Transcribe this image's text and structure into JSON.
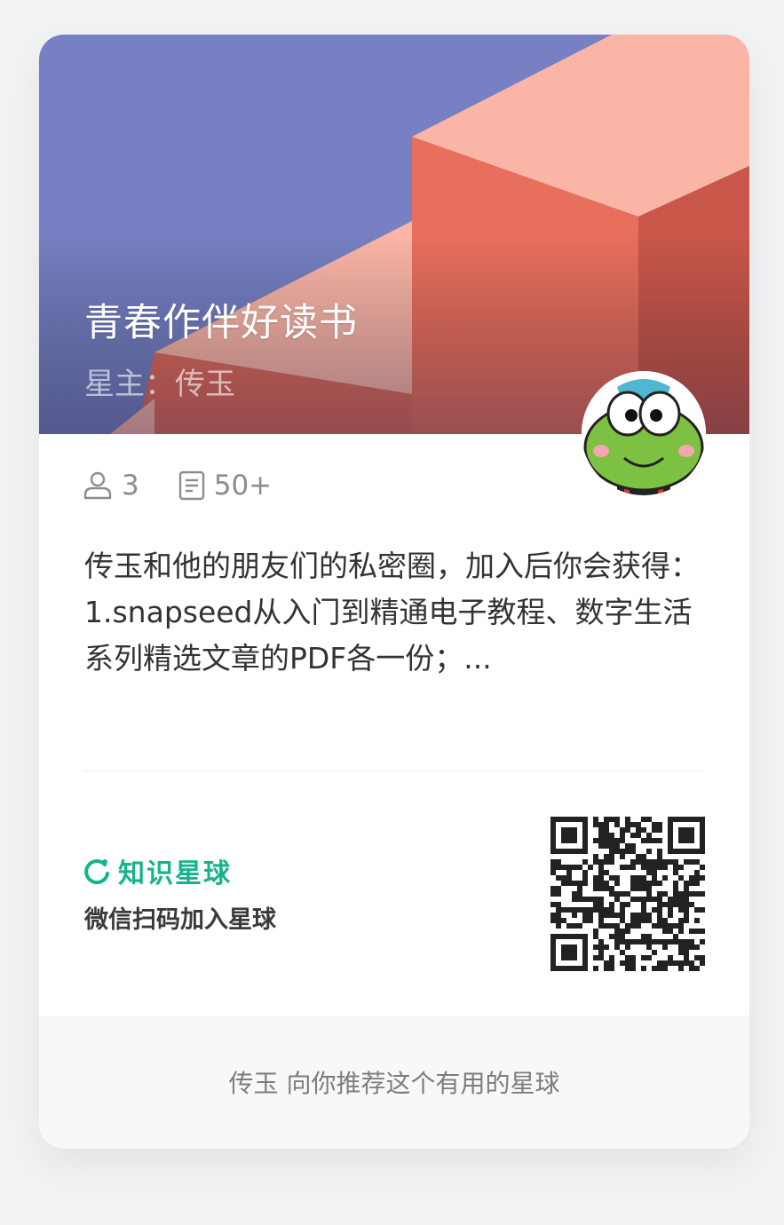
{
  "cover": {
    "title": "青春作伴好读书",
    "owner_label": "星主：传玉"
  },
  "stats": {
    "members": "3",
    "topics": "50+",
    "member_icon": "user-icon",
    "topic_icon": "document-icon"
  },
  "description": {
    "line1": "传玉和他的朋友们的私密圈，加入后你会获得：",
    "line2": "1.snapseed从入门到精通电子教程、数字生活系列精选文章的PDF各一份；..."
  },
  "brand": {
    "name": "知识星球",
    "cta": "微信扫码加入星球",
    "icon": "refresh-circle-icon",
    "color": "#17b38a"
  },
  "footer": {
    "text": "传玉 向你推荐这个有用的星球"
  },
  "colors": {
    "cover_bg": "#7680c2",
    "block_front": "#e86f5c",
    "block_top": "#fab5a6",
    "block_side": "#c9574a"
  }
}
